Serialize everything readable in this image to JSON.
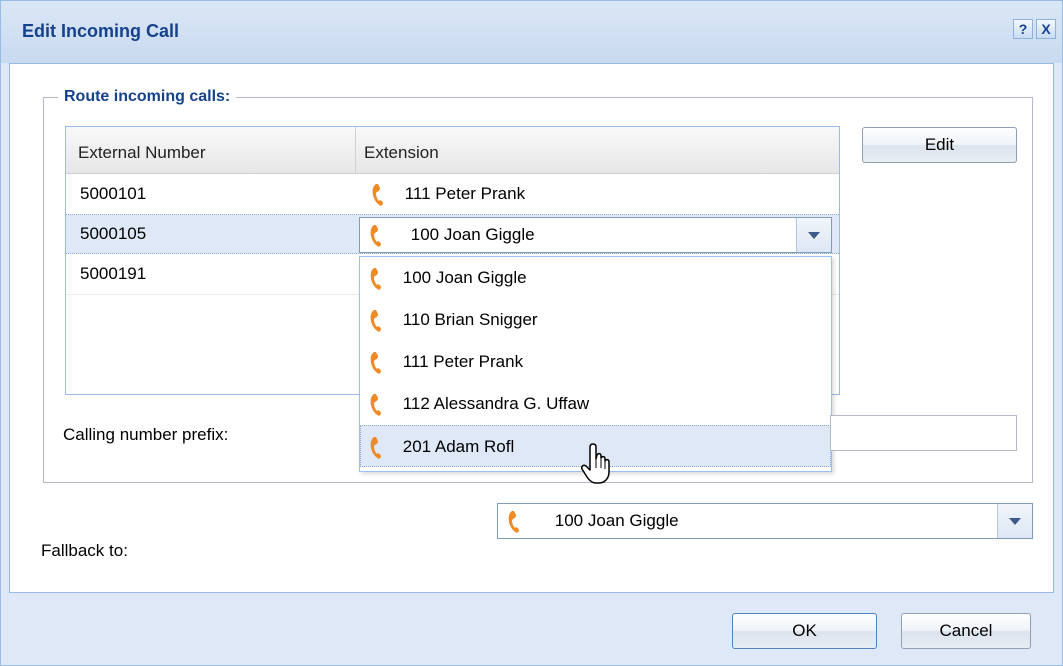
{
  "window": {
    "title": "Edit Incoming Call",
    "help_icon": "?",
    "close_icon": "X"
  },
  "route": {
    "legend": "Route incoming calls:",
    "columns": {
      "external": "External Number",
      "extension": "Extension"
    },
    "rows": [
      {
        "external": "5000101",
        "extension": "111 Peter Prank"
      },
      {
        "external": "5000105",
        "extension": "100 Joan Giggle"
      },
      {
        "external": "5000191",
        "extension": ""
      }
    ],
    "edit_button": "Edit"
  },
  "dropdown": {
    "options": [
      "100 Joan Giggle",
      "110 Brian Snigger",
      "111 Peter Prank",
      "112 Alessandra G. Uffaw",
      "201 Adam Rofl"
    ],
    "highlighted": "201 Adam Rofl"
  },
  "prefix": {
    "label": "Calling number prefix:",
    "value": ""
  },
  "fallback": {
    "label": "Fallback to:",
    "value": "100 Joan Giggle"
  },
  "footer": {
    "ok": "OK",
    "cancel": "Cancel"
  },
  "colors": {
    "title": "#15428b",
    "phone": "#f08a24",
    "selection": "#dfe8f6"
  }
}
